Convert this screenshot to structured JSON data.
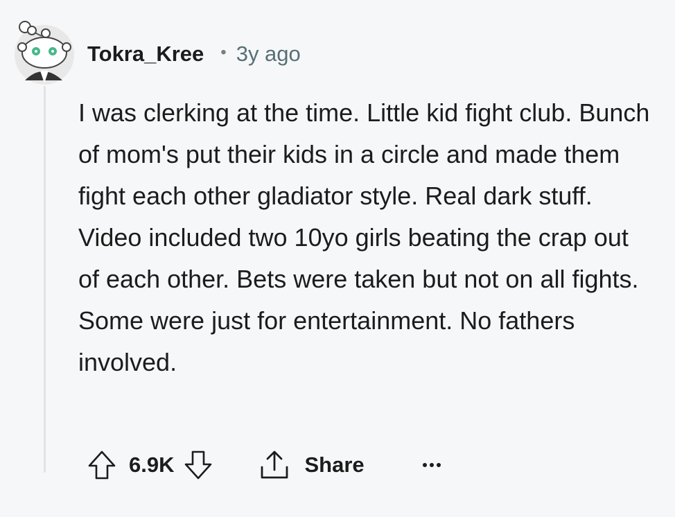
{
  "comment": {
    "author": "Tokra_Kree",
    "separator": "•",
    "timestamp": "3y ago",
    "body": "I was clerking at the time. Little kid fight club. Bunch of mom's put their kids in a circle and made them fight each other gladiator style. Real dark stuff. Video included two 10yo girls beating the crap out of each other. Bets were taken but not on all fights. Some were just for entertainment. No fathers involved."
  },
  "actions": {
    "score": "6.9K",
    "share_label": "Share",
    "upvote_icon": "arrow-up-icon",
    "downvote_icon": "arrow-down-icon",
    "share_icon": "share-icon",
    "more_icon": "more-options-icon"
  },
  "colors": {
    "background": "#f6f7f8",
    "text": "#1c1c1c",
    "meta": "#576f76",
    "thread_line": "#e1e3e5"
  }
}
